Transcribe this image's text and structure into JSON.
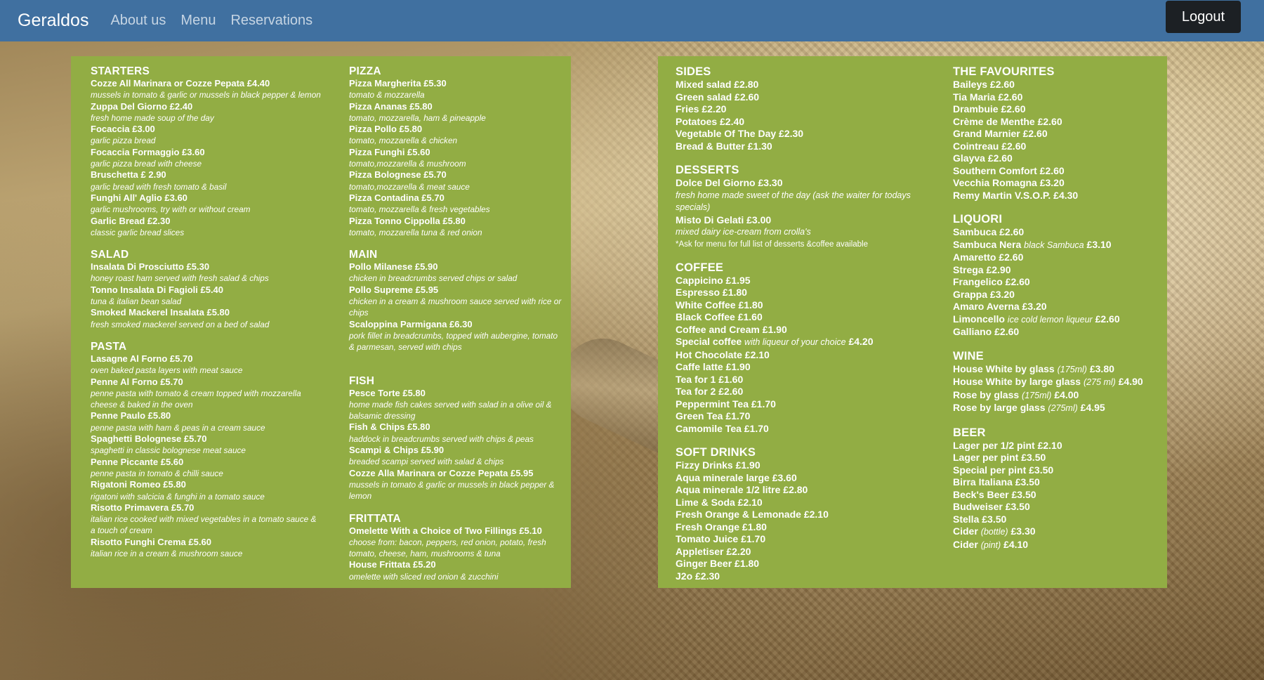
{
  "nav": {
    "brand": "Geraldos",
    "links": [
      "About us",
      "Menu",
      "Reservations"
    ],
    "logout": "Logout"
  },
  "left": {
    "starters": {
      "title": "STARTERS",
      "items": [
        {
          "name": "Cozze All Marinara or Cozze Pepata £4.40",
          "desc": "mussels in tomato & garlic or mussels in black pepper & lemon"
        },
        {
          "name": "Zuppa Del Giorno £2.40",
          "desc": "fresh home made soup of the day"
        },
        {
          "name": "Focaccia £3.00",
          "desc": "garlic pizza bread"
        },
        {
          "name": "Focaccia Formaggio £3.60",
          "desc": "garlic pizza bread with cheese"
        },
        {
          "name": "Bruschetta £ 2.90",
          "desc": "garlic bread with fresh tomato & basil"
        },
        {
          "name": "Funghi All' Aglio £3.60",
          "desc": "garlic mushrooms, try with or without cream"
        },
        {
          "name": "Garlic Bread £2.30",
          "desc": "classic garlic bread slices"
        }
      ]
    },
    "salad": {
      "title": "SALAD",
      "items": [
        {
          "name": "Insalata Di Prosciutto £5.30",
          "desc": "honey roast ham served with fresh salad & chips"
        },
        {
          "name": "Tonno Insalata Di Fagioli £5.40",
          "desc": "tuna & italian bean salad"
        },
        {
          "name": "Smoked Mackerel Insalata £5.80",
          "desc": "fresh smoked mackerel served on a bed of salad"
        }
      ]
    },
    "pasta": {
      "title": "PASTA",
      "items": [
        {
          "name": "Lasagne Al Forno £5.70",
          "desc": "oven baked pasta layers with meat sauce"
        },
        {
          "name": "Penne Al Forno £5.70",
          "desc": "penne pasta with tomato & cream topped with mozzarella cheese & baked in the oven"
        },
        {
          "name": "Penne Paulo £5.80",
          "desc": "penne pasta with ham & peas in a cream sauce"
        },
        {
          "name": "Spaghetti Bolognese £5.70",
          "desc": "spaghetti in classic bolognese meat sauce"
        },
        {
          "name": "Penne Piccante £5.60",
          "desc": "penne pasta in tomato & chilli sauce"
        },
        {
          "name": "Rigatoni Romeo £5.80",
          "desc": "rigatoni with salcicia & funghi in a tomato sauce"
        },
        {
          "name": "Risotto Primavera £5.70",
          "desc": "italian rice cooked with mixed vegetables in a tomato sauce & a touch of cream"
        },
        {
          "name": "Risotto Funghi Crema £5.60",
          "desc": "italian rice in a cream & mushroom sauce"
        }
      ]
    },
    "pizza": {
      "title": "PIZZA",
      "items": [
        {
          "name": "Pizza Margherita £5.30",
          "desc": "tomato & mozzarella"
        },
        {
          "name": "Pizza Ananas £5.80",
          "desc": "tomato, mozzarella, ham & pineapple"
        },
        {
          "name": "Pizza Pollo £5.80",
          "desc": "tomato, mozzarella & chicken"
        },
        {
          "name": "Pizza Funghi £5.60",
          "desc": "tomato,mozzarella & mushroom"
        },
        {
          "name": "Pizza Bolognese £5.70",
          "desc": "tomato,mozzarella & meat sauce"
        },
        {
          "name": "Pizza Contadina £5.70",
          "desc": "tomato, mozzarella & fresh vegetables"
        },
        {
          "name": "Pizza Tonno Cippolla £5.80",
          "desc": "tomato, mozzarella tuna & red onion"
        }
      ]
    },
    "main": {
      "title": "MAIN",
      "items": [
        {
          "name": "Pollo Milanese £5.90",
          "desc": "chicken in breadcrumbs served chips or salad"
        },
        {
          "name": "Pollo Supreme £5.95",
          "desc": "chicken in a cream & mushroom sauce served with rice or chips"
        },
        {
          "name": "Scaloppina Parmigana £6.30",
          "desc": "pork fillet in breadcrumbs, topped with aubergine, tomato & parmesan, served with chips"
        }
      ]
    },
    "fish": {
      "title": "FISH",
      "items": [
        {
          "name": "Pesce Torte £5.80",
          "desc": "home made fish cakes served with salad in a olive oil & balsamic dressing"
        },
        {
          "name": "Fish & Chips £5.80",
          "desc": "haddock in breadcrumbs served with chips & peas"
        },
        {
          "name": "Scampi & Chips £5.90",
          "desc": "breaded scampi served with salad & chips"
        },
        {
          "name": "Cozze Alla Marinara or Cozze Pepata £5.95",
          "desc": "mussels in tomato & garlic or mussels in black pepper & lemon"
        }
      ]
    },
    "frittata": {
      "title": "FRITTATA",
      "items": [
        {
          "name": "Omelette With a Choice of Two Fillings £5.10",
          "desc": "choose from: bacon, peppers, red onion, potato, fresh tomato, cheese, ham, mushrooms & tuna"
        },
        {
          "name": "House Frittata £5.20",
          "desc": "omelette with sliced red onion & zucchini"
        }
      ]
    }
  },
  "right": {
    "sides": {
      "title": "SIDES",
      "items": [
        "Mixed salad £2.80",
        "Green salad £2.60",
        "Fries £2.20",
        "Potatoes £2.40",
        "Vegetable Of The Day £2.30",
        "Bread & Butter £1.30"
      ]
    },
    "desserts": {
      "title": "DESSERTS",
      "dolce": "Dolce Del Giorno £3.30",
      "dolce_desc": "fresh home made sweet of the day (ask the waiter for todays specials)",
      "misto": "Misto Di Gelati £3.00",
      "misto_desc": "mixed dairy ice-cream from crolla's",
      "note": "*Ask for menu for full list of desserts &coffee available"
    },
    "coffee": {
      "title": "COFFEE",
      "items_a": [
        "Cappicino £1.95",
        "Espresso £1.80",
        "White Coffee £1.80",
        "Black Coffee £1.60",
        "Coffee and Cream £1.90"
      ],
      "special_name": "Special coffee",
      "special_desc": "with liqueur of your choice",
      "special_price": "£4.20",
      "items_b": [
        "Hot Chocolate £2.10",
        "Caffe latte £1.90",
        "Tea for 1 £1.60",
        "Tea for 2 £2.60",
        "Peppermint Tea £1.70",
        "Green Tea £1.70",
        "Camomile Tea £1.70"
      ]
    },
    "soft_drinks": {
      "title": "SOFT DRINKS",
      "items": [
        "Fizzy Drinks £1.90",
        "Aqua minerale large £3.60",
        "Aqua minerale 1/2 litre £2.80",
        "Lime & Soda £2.10",
        "Fresh Orange & Lemonade £2.10",
        "Fresh Orange £1.80",
        "Tomato Juice £1.70",
        "Appletiser £2.20",
        "Ginger Beer £1.80",
        "J2o £2.30"
      ]
    },
    "favourites": {
      "title": "THE FAVOURITES",
      "items": [
        "Baileys £2.60",
        "Tia Maria £2.60",
        "Drambuie £2.60",
        "Crème de Menthe £2.60",
        "Grand Marnier £2.60",
        "Cointreau £2.60",
        "Glayva £2.60",
        "Southern Comfort £2.60",
        "Vecchia Romagna £3.20",
        "Remy Martin V.S.O.P. £4.30"
      ]
    },
    "liquori": {
      "title": "LIQUORI",
      "sambuca": "Sambuca £2.60",
      "nera_name": "Sambuca Nera",
      "nera_desc": "black Sambuca",
      "nera_price": "£3.10",
      "items_a": [
        "Amaretto £2.60",
        "Strega £2.90",
        "Frangelico £2.60",
        "Grappa £3.20",
        "Amaro Averna £3.20"
      ],
      "limon_name": "Limoncello",
      "limon_desc": "ice cold lemon liqueur",
      "limon_price": "£2.60",
      "galliano": "Galliano £2.60"
    },
    "wine": {
      "title": "WINE",
      "items": [
        {
          "name": "House White by glass",
          "size": "(175ml)",
          "price": "£3.80"
        },
        {
          "name": "House White by large glass",
          "size": "(275 ml)",
          "price": "£4.90"
        },
        {
          "name": "Rose by glass",
          "size": "(175ml)",
          "price": "£4.00"
        },
        {
          "name": "Rose by large glass",
          "size": "(275ml)",
          "price": "£4.95"
        }
      ]
    },
    "beer": {
      "title": "BEER",
      "items": [
        "Lager per 1/2 pint £2.10",
        "Lager per pint £3.50",
        "Special per pint £3.50",
        "Birra Italiana £3.50",
        "Beck's Beer £3.50",
        "Budweiser £3.50",
        "Stella £3.50"
      ],
      "cider_bottle_name": "Cider",
      "cider_bottle_size": "(bottle)",
      "cider_bottle_price": "£3.30",
      "cider_pint_name": "Cider",
      "cider_pint_size": "(pint)",
      "cider_pint_price": "£4.10"
    }
  }
}
